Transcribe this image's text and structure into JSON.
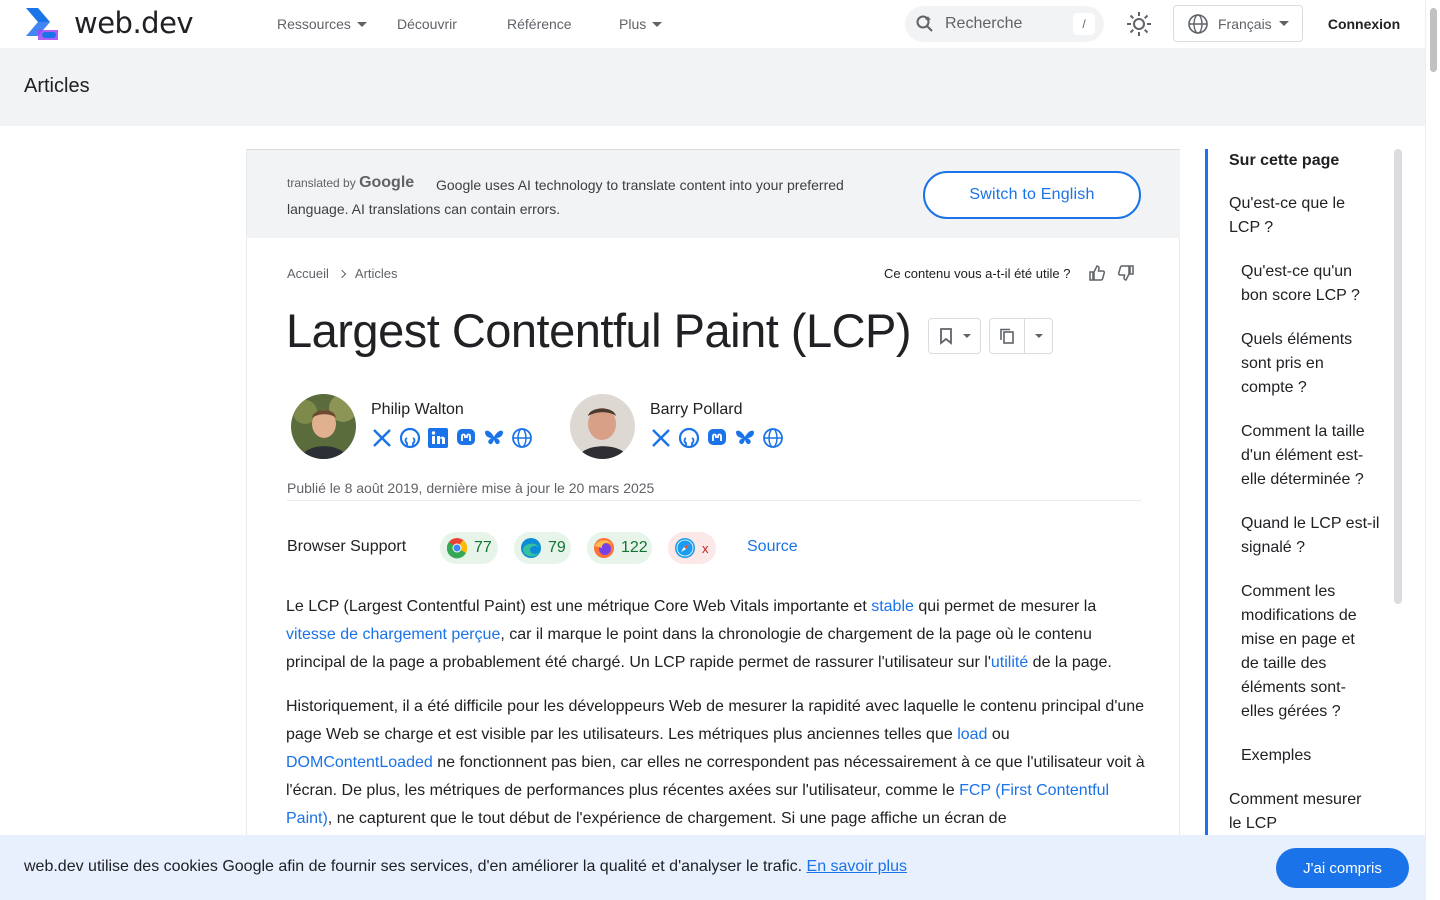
{
  "header": {
    "logo_text": "web.dev",
    "nav": [
      "Ressources",
      "Découvrir",
      "Référence",
      "Plus"
    ],
    "search_placeholder": "Recherche",
    "search_shortcut": "/",
    "language": "Français",
    "login": "Connexion"
  },
  "section": {
    "title": "Articles"
  },
  "translate": {
    "by": "translated by",
    "google": "Google",
    "text": "Google uses AI technology to translate content into your preferred language. AI translations can contain errors.",
    "switch": "Switch to English"
  },
  "breadcrumb": [
    "Accueil",
    "Articles"
  ],
  "helpful": "Ce contenu vous a-t-il été utile ?",
  "article": {
    "title": "Largest Contentful Paint (LCP)",
    "authors": [
      {
        "name": "Philip Walton",
        "socials": [
          "x-icon",
          "github-icon",
          "linkedin-icon",
          "mastodon-icon",
          "bluesky-icon",
          "globe-icon"
        ]
      },
      {
        "name": "Barry Pollard",
        "socials": [
          "x-icon",
          "github-icon",
          "mastodon-icon",
          "bluesky-icon",
          "globe-icon"
        ]
      }
    ],
    "published": "Publié le 8 août 2019, dernière mise à jour le 20 mars 2025",
    "browser_support": {
      "label": "Browser Support",
      "browsers": [
        {
          "icon": "chrome-icon",
          "value": "77"
        },
        {
          "icon": "edge-icon",
          "value": "79"
        },
        {
          "icon": "firefox-icon",
          "value": "122"
        },
        {
          "icon": "safari-icon",
          "value": "x"
        }
      ],
      "source": "Source"
    },
    "p1": {
      "a": "Le LCP (Largest Contentful Paint) est une métrique Core Web Vitals importante et ",
      "link1": "stable",
      "b": " qui permet de mesurer la ",
      "link2": "vitesse de chargement perçue",
      "c": ", car il marque le point dans la chronologie de chargement de la page où le contenu principal de la page a probablement été chargé. Un LCP rapide permet de rassurer l'utilisateur sur l'",
      "link3": "utilité",
      "d": " de la page."
    },
    "p2": {
      "a": "Historiquement, il a été difficile pour les développeurs Web de mesurer la rapidité avec laquelle le contenu principal d'une page Web se charge et est visible par les utilisateurs. Les métriques plus anciennes telles que ",
      "link1": "load",
      "b": " ou ",
      "link2": "DOMContentLoaded",
      "c": " ne fonctionnent pas bien, car elles ne correspondent pas nécessairement à ce que l'utilisateur voit à l'écran. De plus, les métriques de performances plus récentes axées sur l'utilisateur, comme le ",
      "link3": "FCP (First Contentful Paint)",
      "d": ", ne capturent que le tout début de l'expérience de chargement. Si une page affiche un écran de"
    }
  },
  "toc": {
    "title": "Sur cette page",
    "items": [
      "Qu'est-ce que le LCP ?",
      "Qu'est-ce qu'un bon score LCP ?",
      "Quels éléments sont pris en compte ?",
      "Comment la taille d'un élément est-elle déterminée ?",
      "Quand le LCP est-il signalé ?",
      "Comment les modifications de mise en page et de taille des éléments sont-elles gérées ?",
      "Exemples",
      "Comment mesurer le LCP"
    ]
  },
  "cookie": {
    "text": "web.dev utilise des cookies Google afin de fournir ses services, d'en améliorer la qualité et d'analyser le trafic.",
    "link": "En savoir plus",
    "button": "J'ai compris"
  },
  "colors": {
    "accent": "#1a73e8",
    "section_bg": "#f1f3f4",
    "cookie_bg": "#e8f0fe"
  }
}
